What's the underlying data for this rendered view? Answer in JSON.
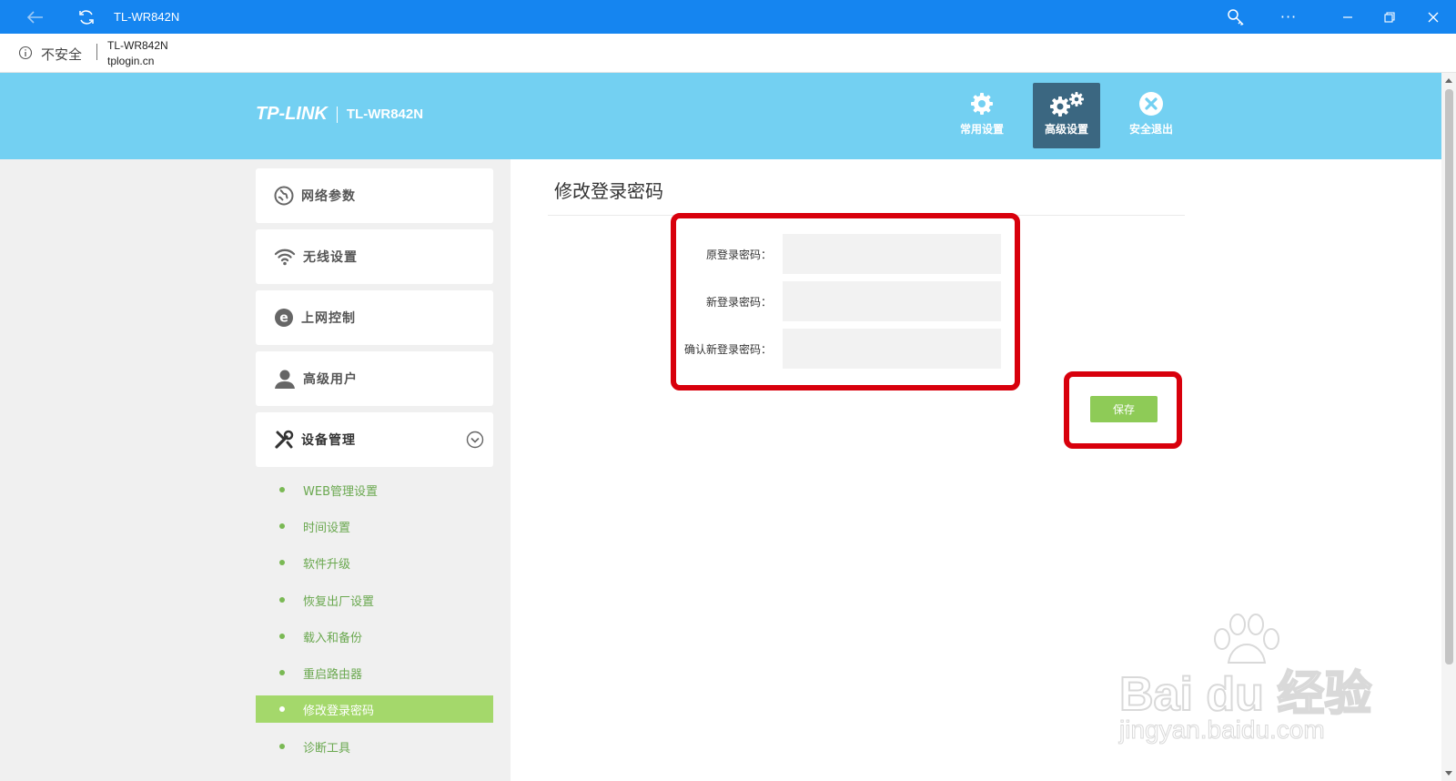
{
  "browser": {
    "title": "TL-WR842N",
    "security_label": "不安全",
    "site_name": "TL-WR842N",
    "url": "tplogin.cn",
    "more_label": "···"
  },
  "header": {
    "brand": "TP-LINK",
    "model": "TL-WR842N",
    "nav": [
      {
        "label": "常用设置",
        "icon": "gear-icon"
      },
      {
        "label": "高级设置",
        "icon": "gears-icon",
        "active": true
      },
      {
        "label": "安全退出",
        "icon": "logout-icon"
      }
    ]
  },
  "sidebar": {
    "sections": [
      {
        "label": "网络参数",
        "icon": "globe-icon"
      },
      {
        "label": "无线设置",
        "icon": "wifi-icon"
      },
      {
        "label": "上网控制",
        "icon": "internet-e-icon"
      },
      {
        "label": "高级用户",
        "icon": "user-icon"
      },
      {
        "label": "设备管理",
        "icon": "tools-icon",
        "expanded": true
      }
    ],
    "device_mgmt_items": [
      {
        "label": "WEB管理设置"
      },
      {
        "label": "时间设置"
      },
      {
        "label": "软件升级"
      },
      {
        "label": "恢复出厂设置"
      },
      {
        "label": "载入和备份"
      },
      {
        "label": "重启路由器"
      },
      {
        "label": "修改登录密码",
        "active": true
      },
      {
        "label": "诊断工具"
      }
    ]
  },
  "main": {
    "title": "修改登录密码",
    "fields": [
      {
        "label": "原登录密码：",
        "value": ""
      },
      {
        "label": "新登录密码：",
        "value": ""
      },
      {
        "label": "确认新登录密码：",
        "value": ""
      }
    ],
    "save_label": "保存"
  },
  "watermark": {
    "main": "Bai du 经验",
    "sub": "jingyan.baidu.com"
  },
  "colors": {
    "titlebar": "#1585f0",
    "header": "#73d0f2",
    "active_nav": "#3b6781",
    "accent_green": "#8ecb57",
    "highlight_red": "#d8000c"
  }
}
